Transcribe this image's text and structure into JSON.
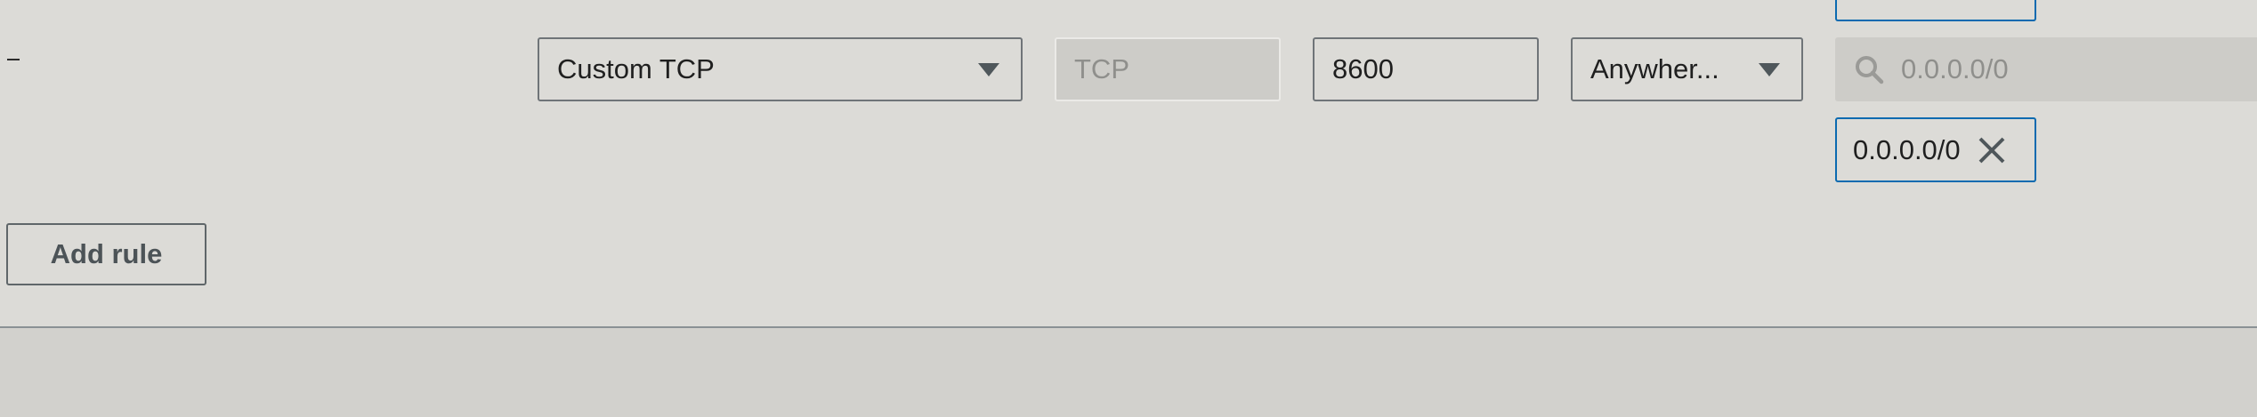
{
  "rule": {
    "remove_label": "–",
    "type": {
      "value": "Custom TCP"
    },
    "protocol": {
      "value": "TCP"
    },
    "port_range": {
      "value": "8600"
    },
    "source_type": {
      "value": "Anywher..."
    },
    "source_search": {
      "placeholder": "0.0.0.0/0"
    },
    "source_tokens": [
      {
        "label": "0.0.0.0/0"
      }
    ]
  },
  "actions": {
    "add_rule_label": "Add rule"
  },
  "icons": {
    "dropdown": "caret-down-icon",
    "search": "search-icon",
    "remove_token": "close-icon"
  },
  "colors": {
    "token_border": "#0b6ab0",
    "field_border": "#6f7478",
    "panel_background": "#dcdbd7"
  }
}
